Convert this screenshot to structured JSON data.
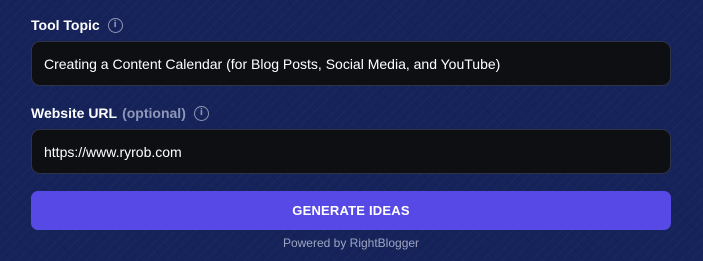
{
  "form": {
    "topic": {
      "label": "Tool Topic",
      "info_icon": "info-icon",
      "value": "Creating a Content Calendar (for Blog Posts, Social Media, and YouTube)"
    },
    "website": {
      "label": "Website URL",
      "optional": "(optional)",
      "info_icon": "info-icon",
      "value": "https://www.ryrob.com"
    },
    "generate_label": "GENERATE IDEAS",
    "powered_by": "Powered by RightBlogger"
  },
  "colors": {
    "background": "#15235a",
    "field_bg": "#0e0f13",
    "button": "#5649e6",
    "muted_text": "#9ea4c0"
  }
}
